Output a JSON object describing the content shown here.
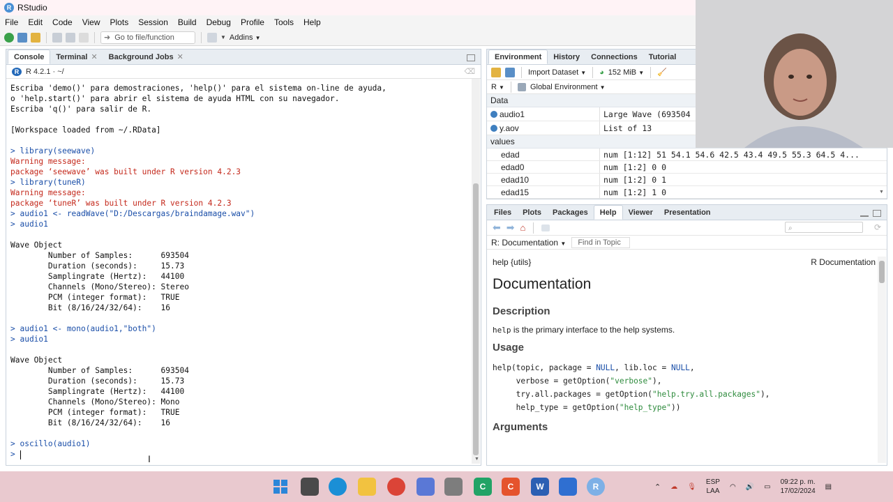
{
  "window": {
    "title": "RStudio",
    "app_icon_letter": "R"
  },
  "menu": [
    "File",
    "Edit",
    "Code",
    "View",
    "Plots",
    "Session",
    "Build",
    "Debug",
    "Profile",
    "Tools",
    "Help"
  ],
  "toolbar": {
    "goto_placeholder": "Go to file/function",
    "addins_label": "Addins"
  },
  "left_tabs": [
    {
      "label": "Console",
      "closable": false
    },
    {
      "label": "Terminal",
      "closable": true
    },
    {
      "label": "Background Jobs",
      "closable": true
    }
  ],
  "console_header": {
    "version": "R 4.2.1 · ~/"
  },
  "console_lines": [
    {
      "type": "out",
      "text": "Escriba 'demo()' para demostraciones, 'help()' para el sistema on-line de ayuda,"
    },
    {
      "type": "out",
      "text": "o 'help.start()' para abrir el sistema de ayuda HTML con su navegador."
    },
    {
      "type": "out",
      "text": "Escriba 'q()' para salir de R."
    },
    {
      "type": "out",
      "text": ""
    },
    {
      "type": "out",
      "text": "[Workspace loaded from ~/.RData]"
    },
    {
      "type": "out",
      "text": ""
    },
    {
      "type": "in",
      "text": "> library(seewave)"
    },
    {
      "type": "warn",
      "text": "Warning message:"
    },
    {
      "type": "warn",
      "text": "package ‘seewave’ was built under R version 4.2.3"
    },
    {
      "type": "in",
      "text": "> library(tuneR)"
    },
    {
      "type": "warn",
      "text": "Warning message:"
    },
    {
      "type": "warn",
      "text": "package ‘tuneR’ was built under R version 4.2.3"
    },
    {
      "type": "in",
      "text": "> audio1 <- readWave(\"D:/Descargas/braindamage.wav\")"
    },
    {
      "type": "in",
      "text": "> audio1"
    },
    {
      "type": "out",
      "text": ""
    },
    {
      "type": "out",
      "text": "Wave Object"
    },
    {
      "type": "out",
      "text": "\tNumber of Samples:      693504"
    },
    {
      "type": "out",
      "text": "\tDuration (seconds):     15.73"
    },
    {
      "type": "out",
      "text": "\tSamplingrate (Hertz):   44100"
    },
    {
      "type": "out",
      "text": "\tChannels (Mono/Stereo): Stereo"
    },
    {
      "type": "out",
      "text": "\tPCM (integer format):   TRUE"
    },
    {
      "type": "out",
      "text": "\tBit (8/16/24/32/64):    16"
    },
    {
      "type": "out",
      "text": ""
    },
    {
      "type": "in",
      "text": "> audio1 <- mono(audio1,\"both\")"
    },
    {
      "type": "in",
      "text": "> audio1"
    },
    {
      "type": "out",
      "text": ""
    },
    {
      "type": "out",
      "text": "Wave Object"
    },
    {
      "type": "out",
      "text": "\tNumber of Samples:      693504"
    },
    {
      "type": "out",
      "text": "\tDuration (seconds):     15.73"
    },
    {
      "type": "out",
      "text": "\tSamplingrate (Hertz):   44100"
    },
    {
      "type": "out",
      "text": "\tChannels (Mono/Stereo): Mono"
    },
    {
      "type": "out",
      "text": "\tPCM (integer format):   TRUE"
    },
    {
      "type": "out",
      "text": "\tBit (8/16/24/32/64):    16"
    },
    {
      "type": "out",
      "text": ""
    },
    {
      "type": "in",
      "text": "> oscillo(audio1)"
    }
  ],
  "prompt": ">",
  "env_tabs": [
    "Environment",
    "History",
    "Connections",
    "Tutorial"
  ],
  "env_toolbar": {
    "import_label": "Import Dataset",
    "memory": "152 MiB",
    "lang": "R",
    "scope": "Global Environment"
  },
  "env_sections": {
    "data_label": "Data",
    "data": [
      {
        "name": "audio1",
        "value": "Large Wave (693504"
      },
      {
        "name": "y.aov",
        "value": "List of  13"
      }
    ],
    "values_label": "values",
    "values": [
      {
        "name": "edad",
        "value": "num [1:12] 51 54.1 54.6 42.5 43.4 49.5 55.3 64.5 4..."
      },
      {
        "name": "edad0",
        "value": "num [1:2] 0 0"
      },
      {
        "name": "edad10",
        "value": "num [1:2] 0 1"
      },
      {
        "name": "edad15",
        "value": "num [1:2] 1 0"
      }
    ]
  },
  "help_tabs": [
    "Files",
    "Plots",
    "Packages",
    "Help",
    "Viewer",
    "Presentation"
  ],
  "help_nav": {
    "topic": "R: Documentation",
    "find_placeholder": "Find in Topic"
  },
  "help_doc": {
    "package": "help {utils}",
    "doc_label": "R Documentation",
    "title": "Documentation",
    "description_heading": "Description",
    "description_code": "help",
    "description_text": " is the primary interface to the help systems.",
    "usage_heading": "Usage",
    "arguments_heading": "Arguments"
  },
  "taskbar": {
    "lang": "ESP",
    "layout": "LAA",
    "time": "09:22 p. m.",
    "date": "17/02/2024"
  }
}
